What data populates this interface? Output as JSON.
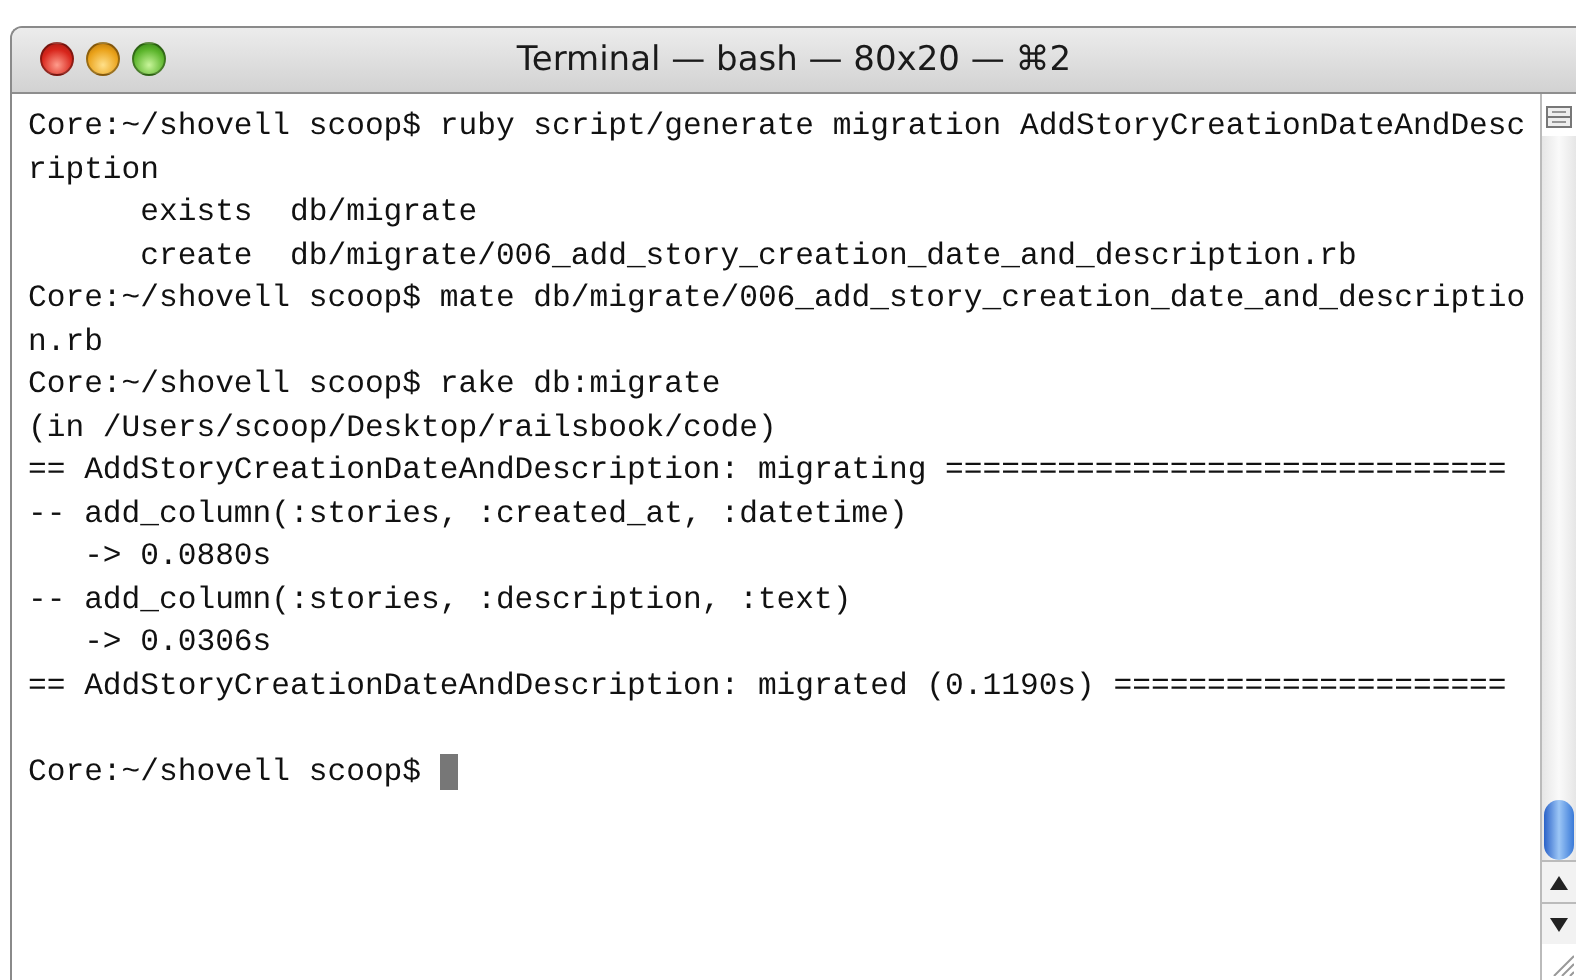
{
  "window": {
    "title": "Terminal — bash — 80x20 — ⌘2"
  },
  "terminal": {
    "cursor_visible": true,
    "lines": [
      {
        "kind": "text",
        "text": "Core:~/shovell scoop$ ruby script/generate migration AddStoryCreationDateAndDesc"
      },
      {
        "kind": "text",
        "text": "ription"
      },
      {
        "kind": "text",
        "text": "      exists  db/migrate"
      },
      {
        "kind": "text",
        "text": "      create  db/migrate/006_add_story_creation_date_and_description.rb"
      },
      {
        "kind": "text",
        "text": "Core:~/shovell scoop$ mate db/migrate/006_add_story_creation_date_and_descriptio"
      },
      {
        "kind": "text",
        "text": "n.rb"
      },
      {
        "kind": "text",
        "text": "Core:~/shovell scoop$ rake db:migrate"
      },
      {
        "kind": "text",
        "text": "(in /Users/scoop/Desktop/railsbook/code)"
      },
      {
        "kind": "text",
        "text": "== AddStoryCreationDateAndDescription: migrating =============================="
      },
      {
        "kind": "text",
        "text": "-- add_column(:stories, :created_at, :datetime)"
      },
      {
        "kind": "text",
        "text": "   -> 0.0880s"
      },
      {
        "kind": "text",
        "text": "-- add_column(:stories, :description, :text)"
      },
      {
        "kind": "text",
        "text": "   -> 0.0306s"
      },
      {
        "kind": "text",
        "text": "== AddStoryCreationDateAndDescription: migrated (0.1190s) ====================="
      },
      {
        "kind": "blank"
      },
      {
        "kind": "prompt",
        "text": "Core:~/shovell scoop$ "
      }
    ]
  }
}
